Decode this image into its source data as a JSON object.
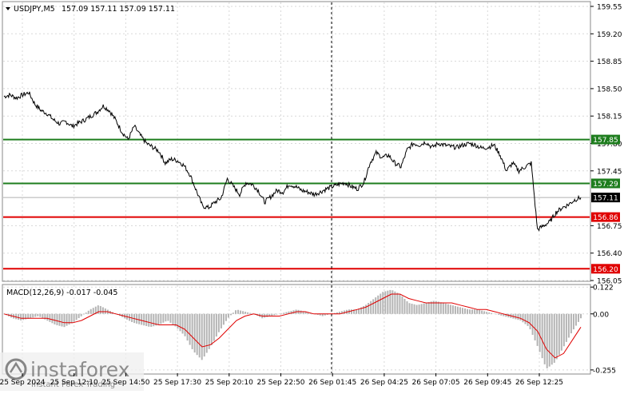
{
  "header": {
    "symbol": "USDJPY,M5",
    "ohlc": "157.09 157.11 157.09 157.11"
  },
  "macd_header": "MACD(12,26,9) -0.017 -0.045",
  "watermark": {
    "brand": "instaforex",
    "tagline": "Instant Forex Trading"
  },
  "colors": {
    "price_line": "#000000",
    "support_green": "#1e7d1e",
    "resistance_red": "#e00000",
    "macd_hist": "#b4b4b4",
    "macd_signal": "#e00000",
    "grid": "#d8d8d8",
    "current_price_bg": "#000000"
  },
  "chart_data": [
    {
      "type": "line",
      "symbol": "USDJPY,M5",
      "ylim": [
        156.0,
        159.6
      ],
      "price_ticks": [
        "159.55",
        "159.20",
        "158.85",
        "158.50",
        "158.15",
        "157.80",
        "157.45",
        "156.75",
        "156.40",
        "156.05"
      ],
      "time_ticks": [
        "25 Sep 2024",
        "25 Sep 12:10",
        "25 Sep 14:50",
        "25 Sep 17:30",
        "25 Sep 20:10",
        "25 Sep 22:50",
        "26 Sep 01:45",
        "26 Sep 04:25",
        "26 Sep 07:05",
        "26 Sep 09:45",
        "26 Sep 12:25"
      ],
      "levels": [
        {
          "value": 157.85,
          "label": "157.85",
          "color": "green"
        },
        {
          "value": 157.29,
          "label": "157.29",
          "color": "green"
        },
        {
          "value": 156.86,
          "label": "156.86",
          "color": "red"
        },
        {
          "value": 156.2,
          "label": "156.20",
          "color": "red"
        }
      ],
      "current_price": {
        "value": 157.11,
        "label": "157.11"
      },
      "close": [
        158.4,
        158.42,
        158.38,
        158.42,
        158.45,
        158.3,
        158.22,
        158.18,
        158.1,
        158.05,
        158.08,
        158.02,
        158.06,
        158.1,
        158.15,
        158.2,
        158.28,
        158.22,
        158.1,
        157.95,
        157.85,
        158.02,
        157.9,
        157.8,
        157.75,
        157.7,
        157.55,
        157.6,
        157.58,
        157.52,
        157.4,
        157.2,
        157.0,
        156.98,
        157.05,
        157.1,
        157.35,
        157.25,
        157.15,
        157.3,
        157.28,
        157.2,
        157.05,
        157.12,
        157.2,
        157.18,
        157.28,
        157.25,
        157.2,
        157.18,
        157.15,
        157.18,
        157.22,
        157.25,
        157.28,
        157.3,
        157.25,
        157.22,
        157.3,
        157.55,
        157.68,
        157.62,
        157.65,
        157.55,
        157.5,
        157.72,
        157.8,
        157.78,
        157.82,
        157.75,
        157.8,
        157.78,
        157.76,
        157.75,
        157.78,
        157.8,
        157.78,
        157.74,
        157.75,
        157.78,
        157.65,
        157.45,
        157.55,
        157.45,
        157.5,
        157.55,
        156.7,
        156.75,
        156.8,
        156.92,
        156.98,
        157.02,
        157.08,
        157.11
      ]
    },
    {
      "type": "bar",
      "name": "MACD(12,26,9)",
      "ylim": [
        -0.27,
        0.13
      ],
      "ticks": [
        "0.122",
        "0.00",
        "-0.255"
      ],
      "histogram": [
        0.0,
        -0.02,
        -0.03,
        -0.02,
        -0.01,
        -0.03,
        -0.05,
        -0.06,
        -0.04,
        -0.01,
        0.02,
        0.04,
        0.02,
        0.0,
        -0.02,
        -0.04,
        -0.05,
        -0.06,
        -0.05,
        -0.03,
        -0.06,
        -0.1,
        -0.17,
        -0.21,
        -0.15,
        -0.08,
        -0.02,
        0.02,
        0.01,
        0.0,
        -0.02,
        -0.01,
        0.0,
        0.01,
        0.02,
        0.01,
        0.0,
        -0.01,
        0.0,
        0.01,
        0.02,
        0.02,
        0.04,
        0.07,
        0.1,
        0.11,
        0.09,
        0.05,
        0.04,
        0.05,
        0.06,
        0.05,
        0.04,
        0.03,
        0.02,
        0.02,
        0.01,
        0.0,
        -0.01,
        -0.02,
        -0.03,
        -0.06,
        -0.15,
        -0.25,
        -0.22,
        -0.15,
        -0.08,
        -0.02
      ],
      "signal": [
        0.0,
        -0.01,
        -0.02,
        -0.02,
        -0.02,
        -0.02,
        -0.03,
        -0.04,
        -0.04,
        -0.03,
        -0.01,
        0.01,
        0.01,
        0.0,
        -0.01,
        -0.02,
        -0.03,
        -0.04,
        -0.05,
        -0.05,
        -0.05,
        -0.07,
        -0.11,
        -0.15,
        -0.14,
        -0.11,
        -0.07,
        -0.03,
        -0.01,
        0.0,
        -0.01,
        -0.01,
        -0.01,
        0.0,
        0.01,
        0.01,
        0.0,
        0.0,
        0.0,
        0.0,
        0.01,
        0.02,
        0.03,
        0.05,
        0.07,
        0.09,
        0.09,
        0.07,
        0.06,
        0.05,
        0.05,
        0.05,
        0.05,
        0.04,
        0.03,
        0.02,
        0.02,
        0.01,
        0.0,
        -0.01,
        -0.02,
        -0.04,
        -0.08,
        -0.16,
        -0.2,
        -0.18,
        -0.12,
        -0.06
      ]
    }
  ]
}
